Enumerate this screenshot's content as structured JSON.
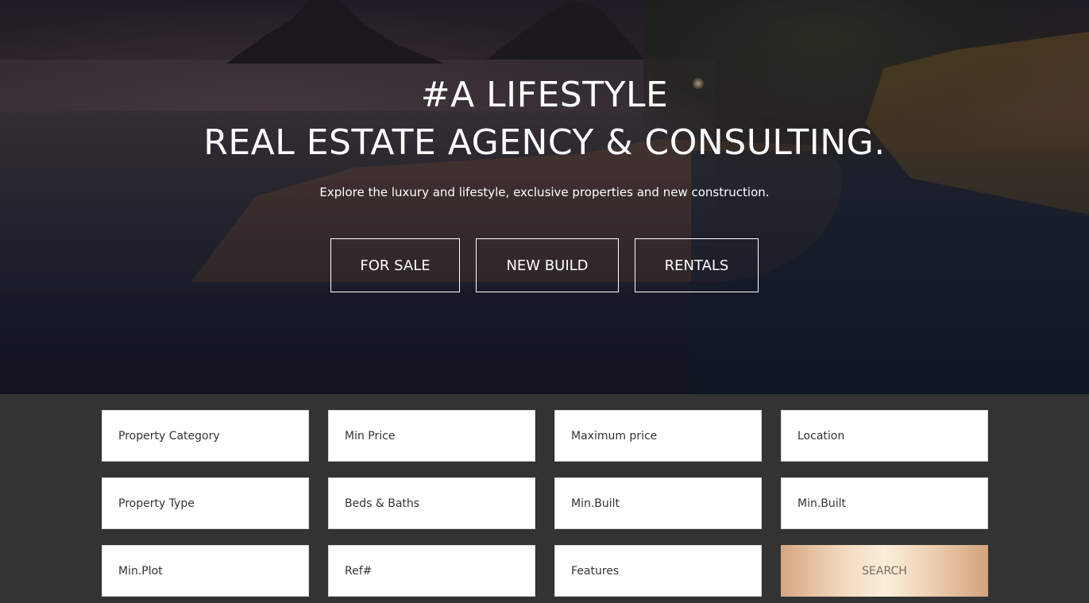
{
  "hero": {
    "title_line1": "#A LIFESTYLE",
    "title_line2": "REAL ESTATE AGENCY & CONSULTING.",
    "subtitle": "Explore the luxury and lifestyle, exclusive properties and new construction.",
    "buttons": [
      {
        "label": "FOR SALE"
      },
      {
        "label": "NEW BUILD"
      },
      {
        "label": "RENTALS"
      }
    ]
  },
  "search": {
    "fields": [
      {
        "label": "Property Category"
      },
      {
        "label": "Min Price"
      },
      {
        "label": "Maximum price"
      },
      {
        "label": "Location"
      },
      {
        "label": "Property Type"
      },
      {
        "label": "Beds & Baths"
      },
      {
        "label": "Min.Built"
      },
      {
        "label": "Min.Built"
      },
      {
        "label": "Min.Plot"
      },
      {
        "label": "Ref#"
      },
      {
        "label": "Features"
      }
    ],
    "submit_label": "SEARCH"
  },
  "colors": {
    "panel_background": "#333333",
    "field_background": "#ffffff",
    "search_button_gold": "#d7a681",
    "search_button_text": "#7d6b5e"
  }
}
